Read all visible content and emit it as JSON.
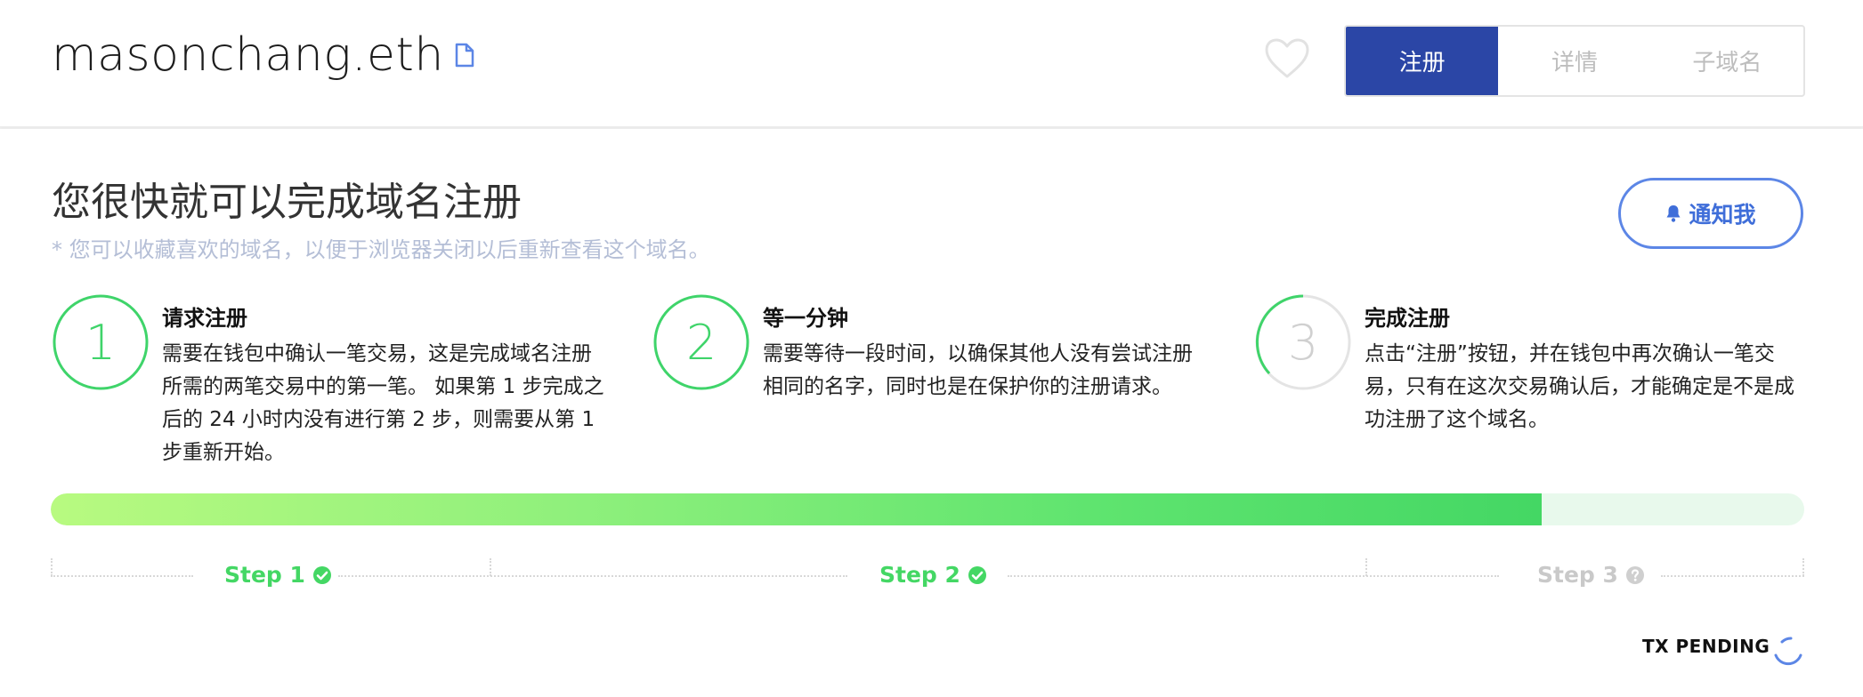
{
  "header": {
    "domain": "masonchang.eth",
    "tabs": [
      {
        "label": "注册",
        "active": true
      },
      {
        "label": "详情",
        "active": false
      },
      {
        "label": "子域名",
        "active": false
      }
    ]
  },
  "main": {
    "title": "您很快就可以完成域名注册",
    "note": "* 您可以收藏喜欢的域名，以便于浏览器关闭以后重新查看这个域名。",
    "notify_label": "通知我"
  },
  "steps": [
    {
      "number": "1",
      "title": "请求注册",
      "description": "需要在钱包中确认一笔交易，这是完成域名注册所需的两笔交易中的第一笔。 如果第 1 步完成之后的 24 小时内没有进行第 2 步，则需要从第 1 步重新开始。"
    },
    {
      "number": "2",
      "title": "等一分钟",
      "description": "需要等待一段时间，以确保其他人没有尝试注册相同的名字，同时也是在保护你的注册请求。"
    },
    {
      "number": "3",
      "title": "完成注册",
      "description": "点击“注册”按钮，并在钱包中再次确认一笔交易，只有在这次交易确认后，才能确定是不是成功注册了这个域名。"
    }
  ],
  "progress": {
    "fraction": 0.85
  },
  "step_markers": [
    {
      "label": "Step 1",
      "status": "done"
    },
    {
      "label": "Step 2",
      "status": "done"
    },
    {
      "label": "Step 3",
      "status": "pending"
    }
  ],
  "tx_status": "TX PENDING",
  "colors": {
    "accent_blue": "#2b46a6",
    "link_blue": "#3f6ed9",
    "success_green": "#44d764",
    "muted_grey": "#c9c9c9"
  },
  "icons": {
    "copy": "document-icon",
    "favorite": "heart-icon",
    "notify": "bell-icon",
    "done": "check-circle-icon",
    "pending": "question-circle-icon",
    "loading": "spinner-icon"
  }
}
